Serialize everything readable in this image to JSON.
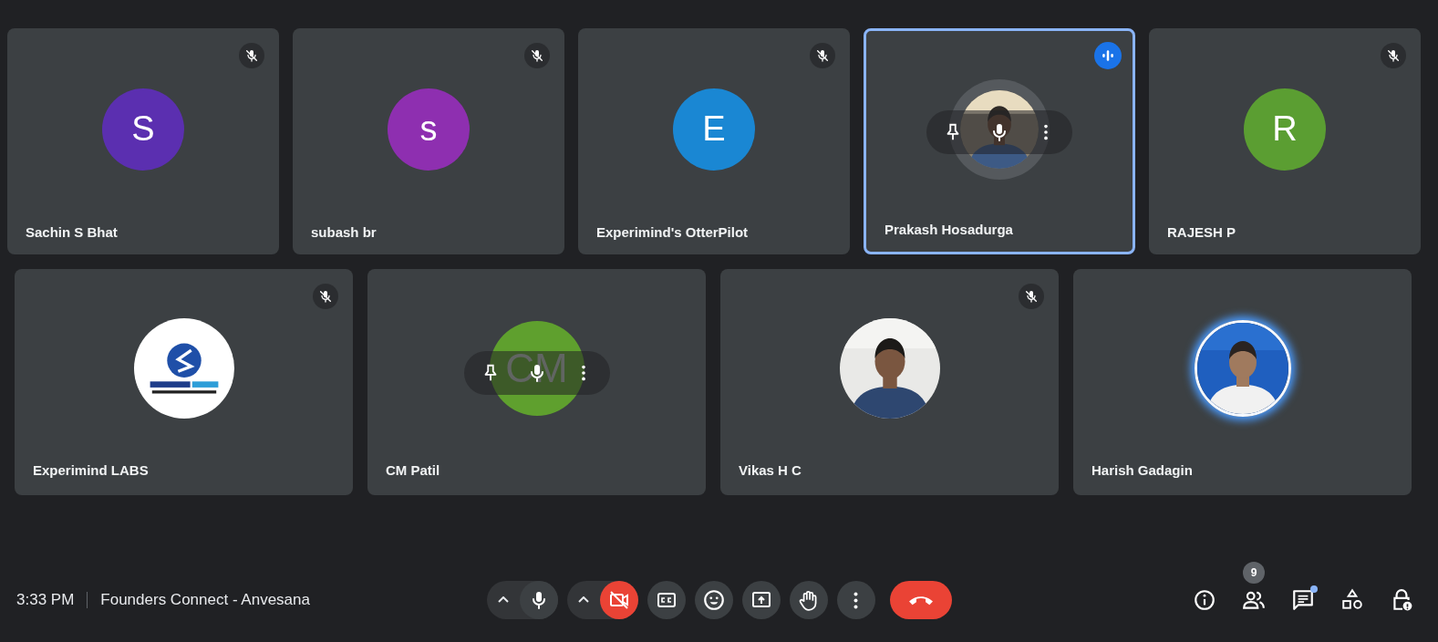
{
  "tiles": [
    {
      "name": "Sachin S Bhat",
      "avatar": {
        "kind": "letter",
        "letter": "S",
        "color": "#5b2fb0"
      },
      "muted": true,
      "speaking": false,
      "hover_controls": false
    },
    {
      "name": "subash br",
      "avatar": {
        "kind": "letter",
        "letter": "s",
        "color": "#8e2fb0"
      },
      "muted": true,
      "speaking": false,
      "hover_controls": false
    },
    {
      "name": "Experimind's OtterPilot",
      "avatar": {
        "kind": "letter",
        "letter": "E",
        "color": "#1a87d3"
      },
      "muted": true,
      "speaking": false,
      "hover_controls": false
    },
    {
      "name": "Prakash Hosadurga",
      "muted": false,
      "speaking": true,
      "hover_controls": true
    },
    {
      "name": "RAJESH P",
      "avatar": {
        "kind": "letter",
        "letter": "R",
        "color": "#5b9e32"
      },
      "muted": true,
      "speaking": false,
      "hover_controls": false
    },
    {
      "name": "Experimind LABS",
      "avatar": {
        "kind": "logo"
      },
      "muted": true,
      "speaking": false,
      "hover_controls": false
    },
    {
      "name": "CM Patil",
      "avatar": {
        "kind": "letter",
        "letter": "CM",
        "color": "#5fa02e"
      },
      "muted": false,
      "speaking": false,
      "hover_controls": true
    },
    {
      "name": "Vikas H C",
      "muted": true,
      "speaking": false,
      "hover_controls": false
    },
    {
      "name": "Harish Gadagin",
      "muted": false,
      "speaking": false,
      "hover_controls": false,
      "glow": true
    }
  ],
  "meeting": {
    "time": "3:33 PM",
    "title": "Founders Connect - Anvesana"
  },
  "controls": [
    {
      "kind": "mic",
      "on": true,
      "has_menu": true
    },
    {
      "kind": "camera",
      "on": false,
      "has_menu": true
    },
    {
      "kind": "captions"
    },
    {
      "kind": "reactions"
    },
    {
      "kind": "present"
    },
    {
      "kind": "raise-hand"
    },
    {
      "kind": "more"
    },
    {
      "kind": "leave"
    }
  ],
  "side_controls": [
    {
      "kind": "info"
    },
    {
      "kind": "people",
      "badge": "9"
    },
    {
      "kind": "chat",
      "unread": true
    },
    {
      "kind": "activities"
    },
    {
      "kind": "host-controls"
    }
  ]
}
